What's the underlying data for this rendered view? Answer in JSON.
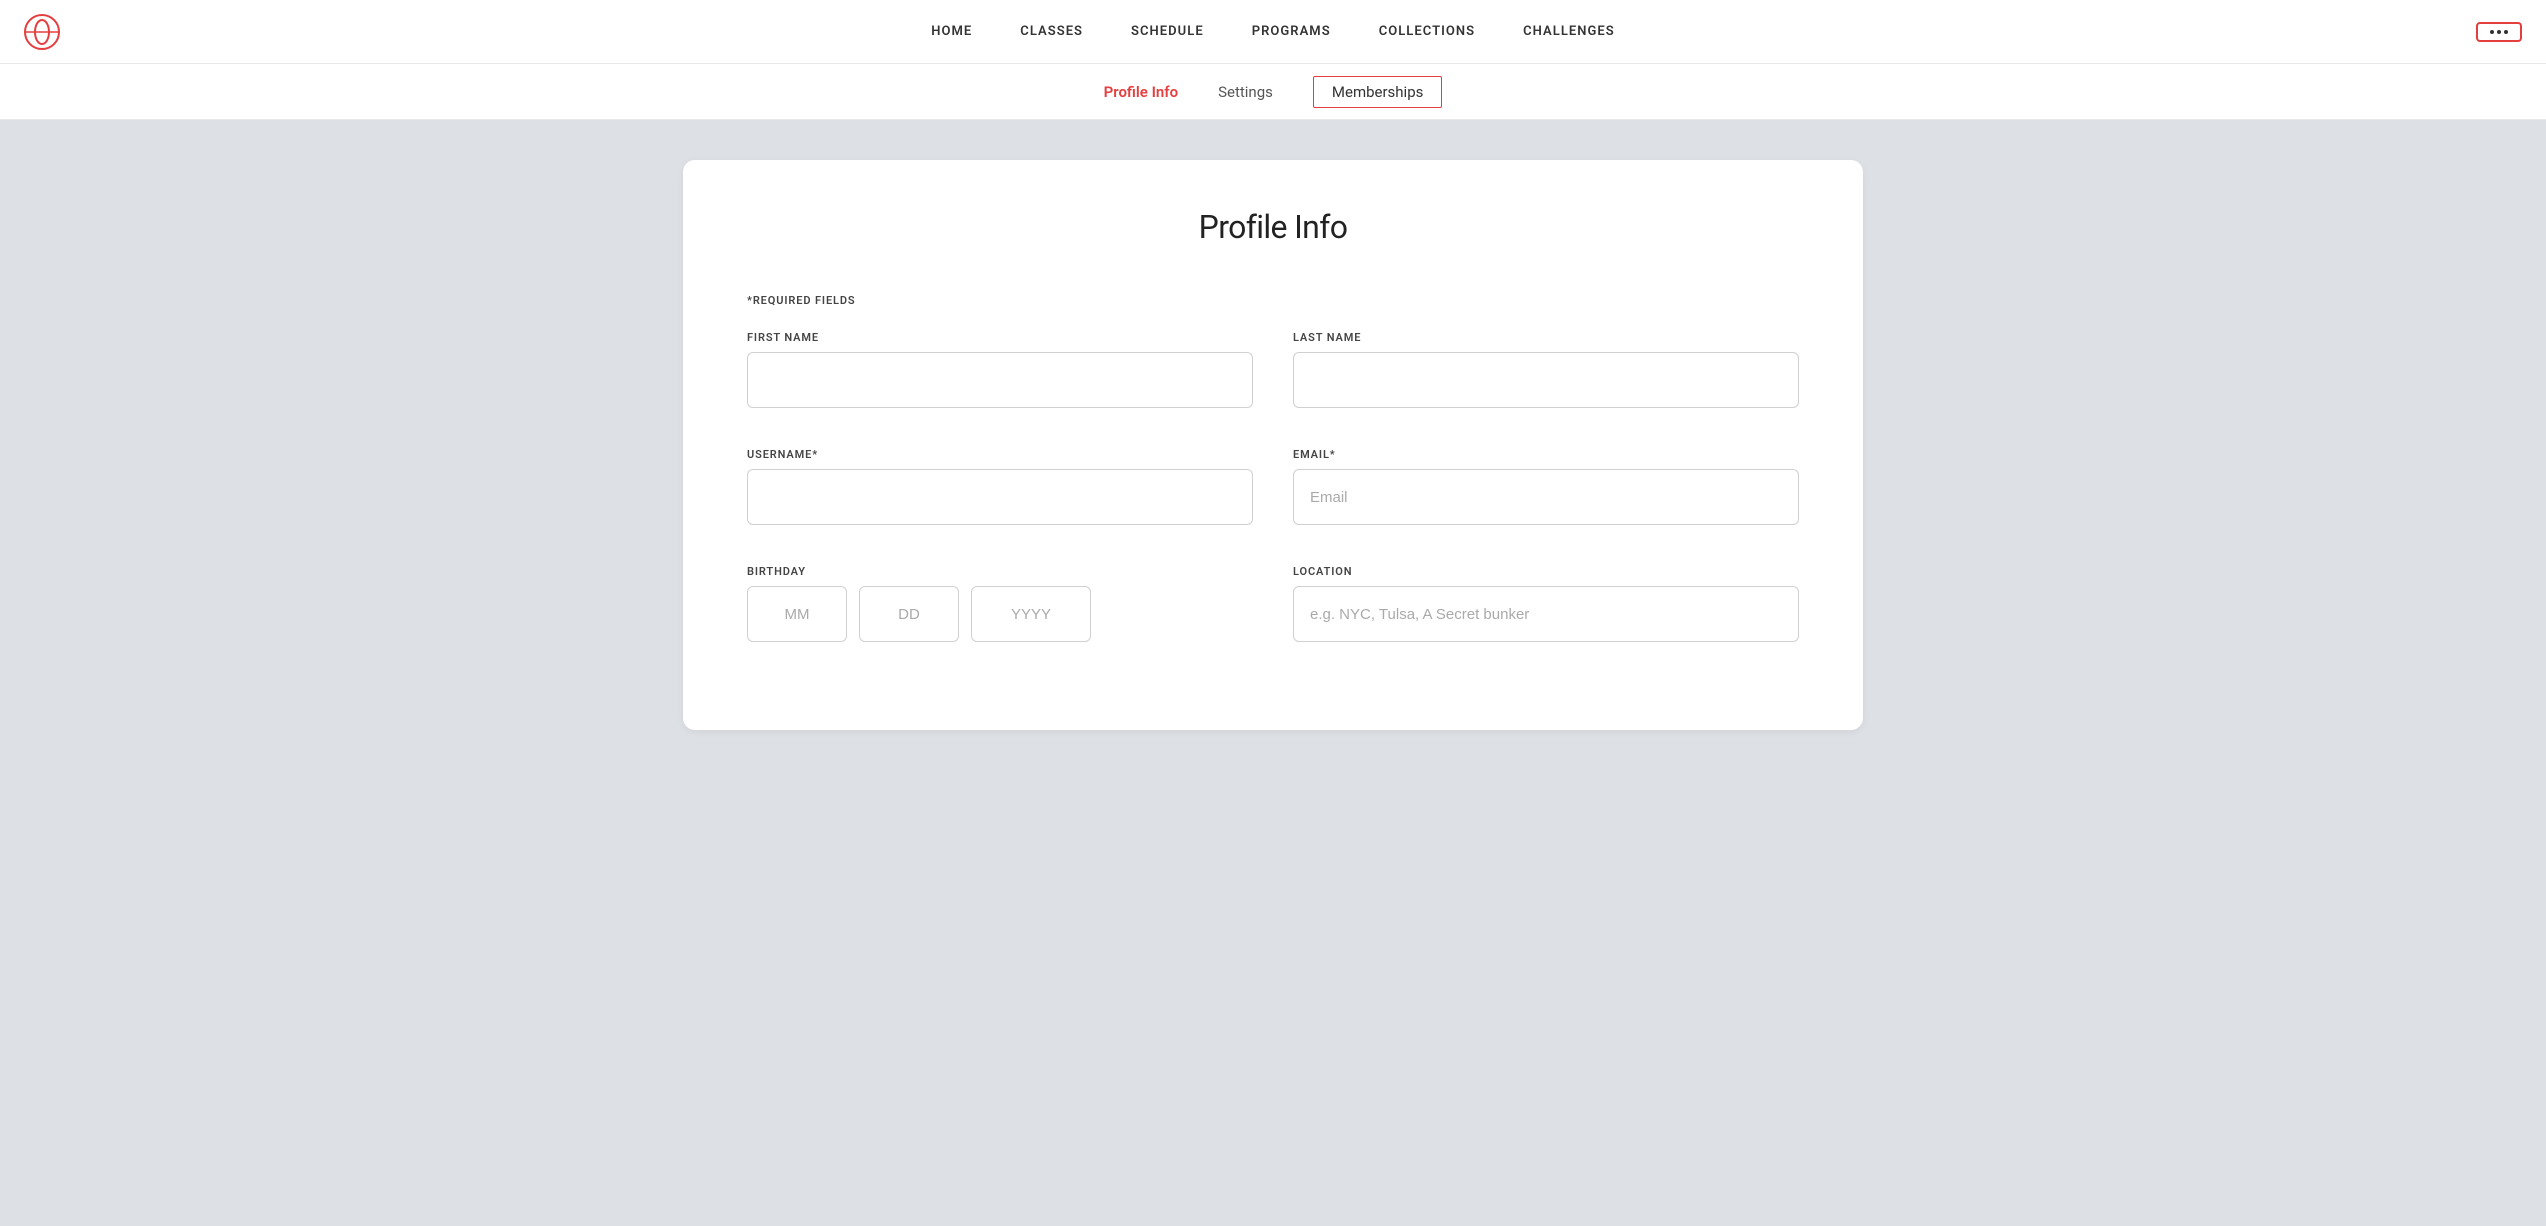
{
  "nav": {
    "logo_alt": "Peloton",
    "links": [
      {
        "id": "home",
        "label": "HOME"
      },
      {
        "id": "classes",
        "label": "CLASSES"
      },
      {
        "id": "schedule",
        "label": "SCHEDULE"
      },
      {
        "id": "programs",
        "label": "PROGRAMS"
      },
      {
        "id": "collections",
        "label": "COLLECTIONS"
      },
      {
        "id": "challenges",
        "label": "CHALLENGES"
      }
    ],
    "more_button_label": "···"
  },
  "sub_nav": {
    "tabs": [
      {
        "id": "profile-info",
        "label": "Profile Info",
        "active": true,
        "bordered": false
      },
      {
        "id": "settings",
        "label": "Settings",
        "active": false,
        "bordered": false
      },
      {
        "id": "memberships",
        "label": "Memberships",
        "active": false,
        "bordered": true
      }
    ]
  },
  "profile_form": {
    "title": "Profile Info",
    "required_note": "*REQUIRED FIELDS",
    "fields": {
      "first_name_label": "FIRST NAME",
      "last_name_label": "LAST NAME",
      "username_label": "USERNAME*",
      "email_label": "EMAIL*",
      "birthday_label": "BIRTHDAY",
      "location_label": "LOCATION"
    },
    "placeholders": {
      "first_name": "",
      "last_name": "",
      "username": "",
      "email": "Email",
      "birthday_mm": "MM",
      "birthday_dd": "DD",
      "birthday_yyyy": "YYYY",
      "location": "e.g. NYC, Tulsa, A Secret bunker"
    }
  }
}
